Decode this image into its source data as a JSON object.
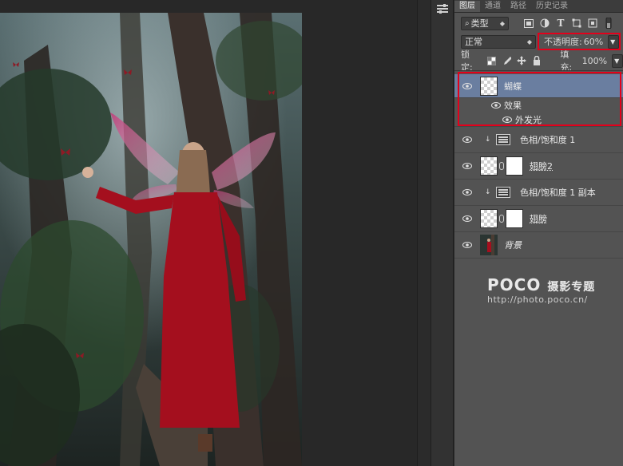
{
  "panel": {
    "tabs": [
      "图层",
      "通道",
      "路径",
      "历史记录"
    ],
    "filter_label": "类型",
    "blend_mode": "正常",
    "opacity_label": "不透明度:",
    "opacity_value": "60%",
    "lock_label": "锁定:",
    "fill_label": "填充:",
    "fill_value": "100%"
  },
  "layers": [
    {
      "name": "蝴蝶",
      "selected": true,
      "effects_label": "效果",
      "effect_item": "外发光"
    },
    {
      "name": "色相/饱和度 1",
      "type": "adjustment",
      "clipped": true
    },
    {
      "name": "翅膀2",
      "type": "masked"
    },
    {
      "name": "色相/饱和度 1 副本",
      "type": "adjustment",
      "clipped": true
    },
    {
      "name": "翅膀",
      "type": "masked"
    },
    {
      "name": "背景",
      "type": "background"
    }
  ],
  "watermark": {
    "brand": "POCO",
    "subtitle": "摄影专题",
    "url": "http://photo.poco.cn/"
  },
  "colors": {
    "highlight": "#e3001b",
    "selected_layer": "#6a7ea0",
    "panel_bg": "#535353"
  }
}
